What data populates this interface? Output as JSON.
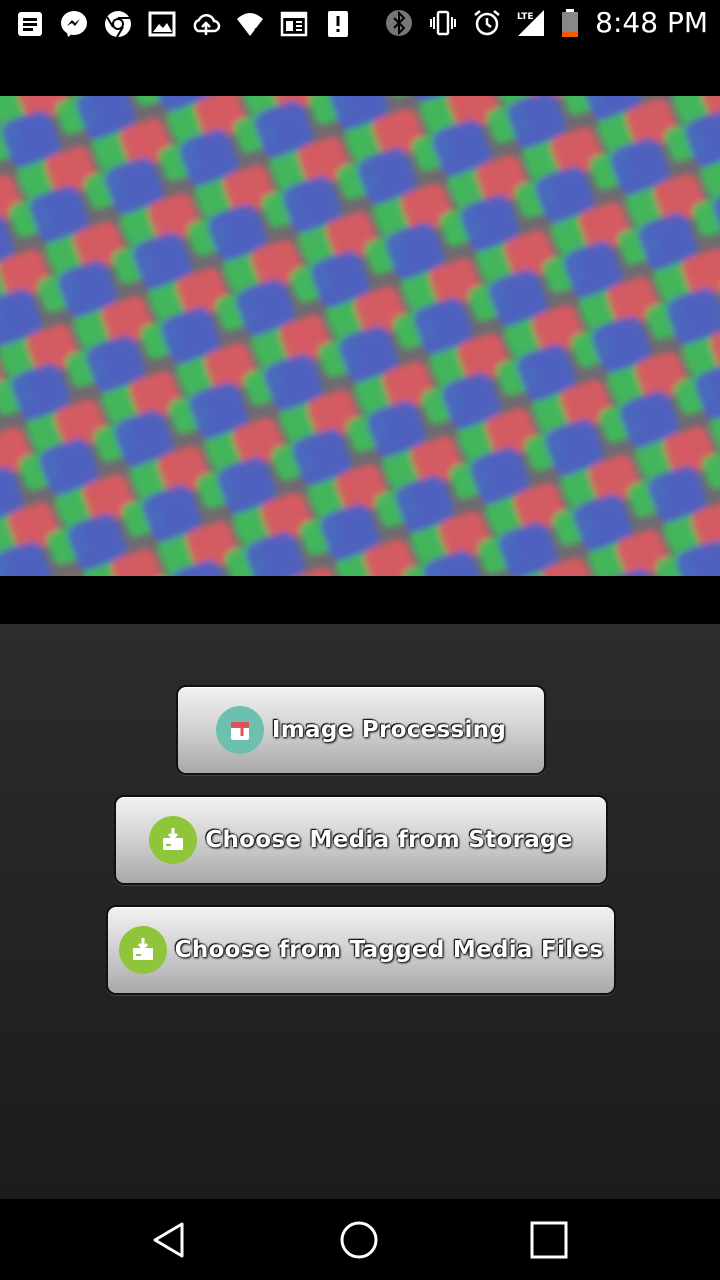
{
  "status_bar": {
    "time": "8:48 PM",
    "network": "LTE",
    "icons_left": [
      "notes-icon",
      "messenger-icon",
      "chrome-icon",
      "image-icon",
      "cloud-upload-icon",
      "wifi-question-icon",
      "news-icon",
      "alert-icon"
    ],
    "icons_right": [
      "bluetooth-icon",
      "vibrate-icon",
      "alarm-icon",
      "signal-icon",
      "battery-icon"
    ]
  },
  "preview": {
    "colors": {
      "red": "#e05a5f",
      "green": "#3fbf5a",
      "blue": "#4a5fc8",
      "background": "#6e6a70"
    }
  },
  "buttons": {
    "image_processing": "Image Processing",
    "choose_storage": "Choose Media from Storage",
    "choose_tagged": "Choose from Tagged Media Files"
  },
  "navigation": [
    "back-icon",
    "home-icon",
    "recents-icon"
  ]
}
